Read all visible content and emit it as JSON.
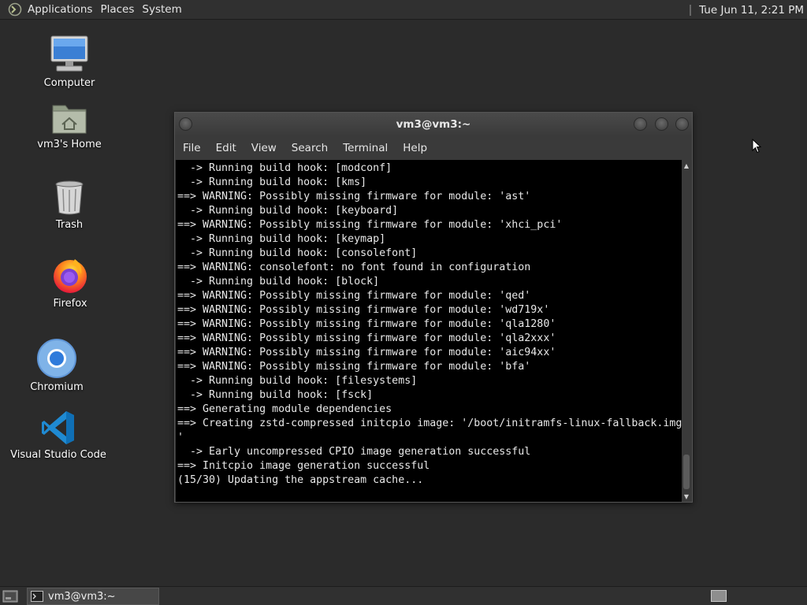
{
  "top_panel": {
    "menus": [
      "Applications",
      "Places",
      "System"
    ],
    "clock": "Tue Jun 11,  2:21 PM"
  },
  "desktop_icons": [
    {
      "label": "Computer",
      "icon": "computer-icon"
    },
    {
      "label": "vm3's Home",
      "icon": "home-folder-icon"
    },
    {
      "label": "Trash",
      "icon": "trash-icon"
    },
    {
      "label": "Firefox",
      "icon": "firefox-icon"
    },
    {
      "label": "Chromium",
      "icon": "chromium-icon"
    },
    {
      "label": "Visual Studio Code",
      "icon": "vscode-icon"
    }
  ],
  "terminal": {
    "title": "vm3@vm3:~",
    "menu": [
      "File",
      "Edit",
      "View",
      "Search",
      "Terminal",
      "Help"
    ],
    "lines": [
      "  -> Running build hook: [modconf]",
      "  -> Running build hook: [kms]",
      "==> WARNING: Possibly missing firmware for module: 'ast'",
      "  -> Running build hook: [keyboard]",
      "==> WARNING: Possibly missing firmware for module: 'xhci_pci'",
      "  -> Running build hook: [keymap]",
      "  -> Running build hook: [consolefont]",
      "==> WARNING: consolefont: no font found in configuration",
      "  -> Running build hook: [block]",
      "==> WARNING: Possibly missing firmware for module: 'qed'",
      "==> WARNING: Possibly missing firmware for module: 'wd719x'",
      "==> WARNING: Possibly missing firmware for module: 'qla1280'",
      "==> WARNING: Possibly missing firmware for module: 'qla2xxx'",
      "==> WARNING: Possibly missing firmware for module: 'aic94xx'",
      "==> WARNING: Possibly missing firmware for module: 'bfa'",
      "  -> Running build hook: [filesystems]",
      "  -> Running build hook: [fsck]",
      "==> Generating module dependencies",
      "==> Creating zstd-compressed initcpio image: '/boot/initramfs-linux-fallback.img",
      "'",
      "  -> Early uncompressed CPIO image generation successful",
      "==> Initcpio image generation successful",
      "(15/30) Updating the appstream cache..."
    ]
  },
  "taskbar": {
    "tasks": [
      {
        "label": "vm3@vm3:~",
        "icon": "terminal-icon"
      }
    ]
  },
  "colors": {
    "panel": "#303030",
    "desktop": "#2b2b2b",
    "terminal_bg": "#000000",
    "terminal_fg": "#e8e8e8"
  }
}
